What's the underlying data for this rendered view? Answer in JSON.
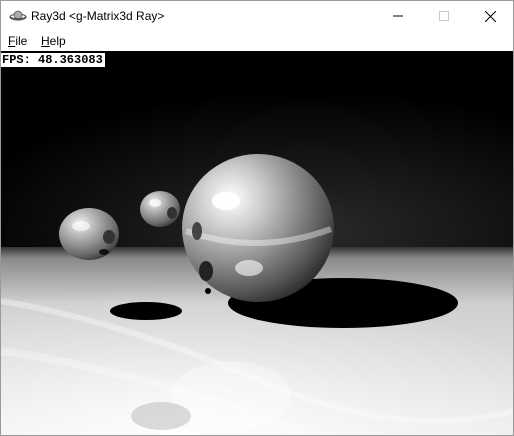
{
  "window": {
    "title": "Ray3d <g-Matrix3d Ray>",
    "app_icon": "saturn-icon",
    "controls": [
      "minimize-icon",
      "maximize-icon",
      "close-icon"
    ]
  },
  "menu": {
    "items": [
      {
        "accel": "F",
        "rest": "ile"
      },
      {
        "accel": "H",
        "rest": "elp"
      }
    ]
  },
  "overlay": {
    "fps_text": "FPS: 48.363083"
  },
  "scene": {
    "description_colors": {
      "background": "#000000",
      "floor_near": "#ffffff",
      "sphere": "#bdbdbd"
    }
  }
}
